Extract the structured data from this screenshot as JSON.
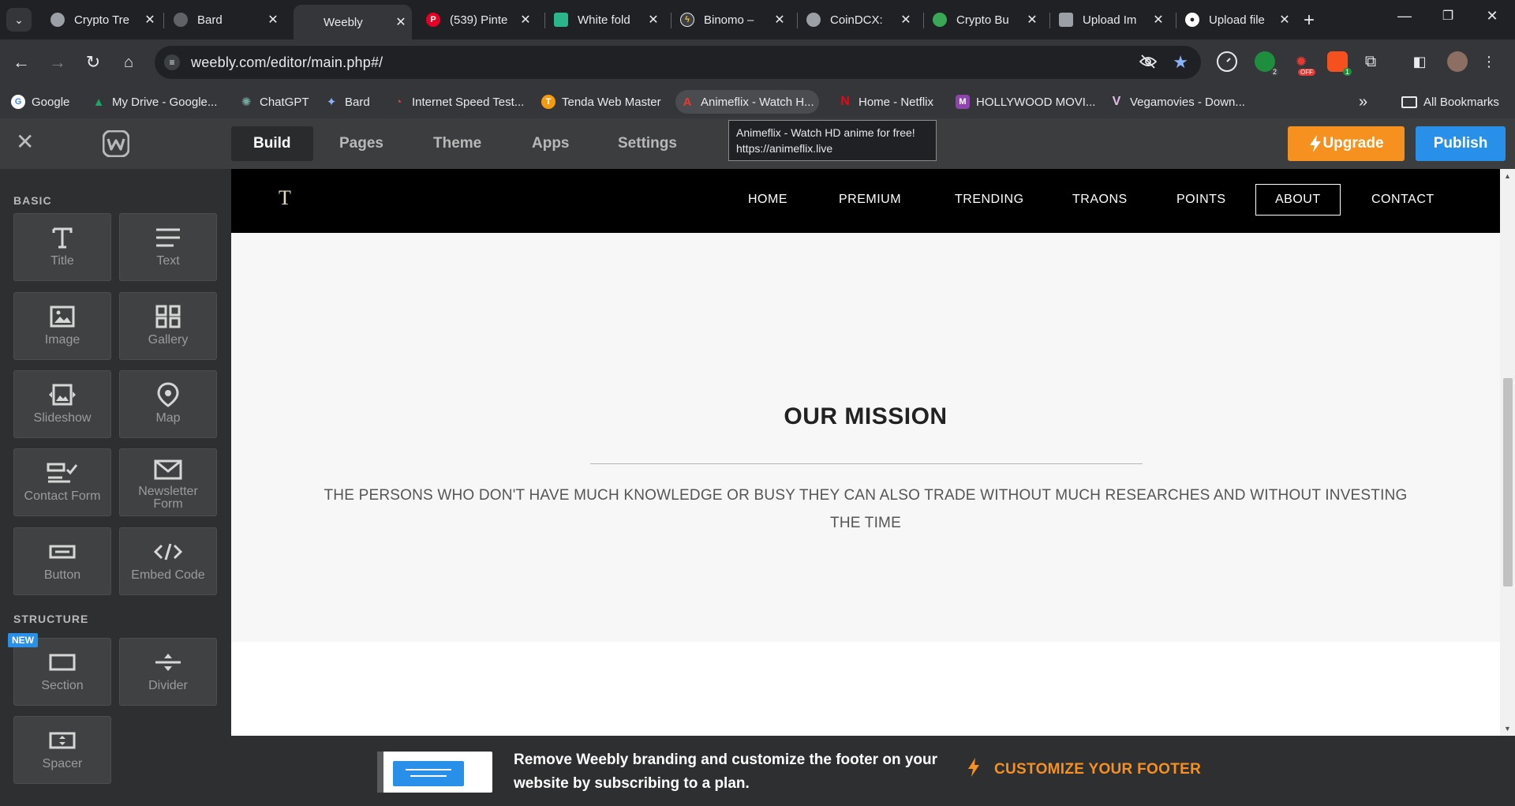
{
  "browser": {
    "tabs": [
      {
        "title": "Crypto Tre",
        "favicon_color": "#9aa0a6"
      },
      {
        "title": "Bard",
        "favicon_color": "#5f6368"
      },
      {
        "title": "Weebly",
        "favicon_color": "#35363a"
      },
      {
        "title": "(539) Pinte",
        "favicon_color": "#e60023"
      },
      {
        "title": "White fold",
        "favicon_color": "#2bb58a"
      },
      {
        "title": "Binomo – ",
        "favicon_color": "#3c4043"
      },
      {
        "title": "CoinDCX: ",
        "favicon_color": "#9aa0a6"
      },
      {
        "title": "Crypto Bu",
        "favicon_color": "#3aa757"
      },
      {
        "title": "Upload Im",
        "favicon_color": "#9aa0a6"
      },
      {
        "title": "Upload file",
        "favicon_color": "#ffffff"
      }
    ],
    "active_tab_index": 2,
    "close_glyph": "✕",
    "new_tab_glyph": "+",
    "url": "weebly.com/editor/main.php#/",
    "extension_badges": {
      "ext2": "2",
      "ext3": "OFF",
      "ext4": "1"
    },
    "bookmarks": [
      {
        "label": "Google",
        "color": "#ffffff",
        "glyph": "G"
      },
      {
        "label": "My Drive - Google...",
        "color": "#1fa463",
        "glyph": "▲"
      },
      {
        "label": "ChatGPT",
        "color": "#74aa9c",
        "glyph": "✺"
      },
      {
        "label": "Bard",
        "color": "#4285f4",
        "glyph": "✦"
      },
      {
        "label": "Internet Speed Test...",
        "color": "#c62828",
        "glyph": "◔"
      },
      {
        "label": "Tenda Web Master",
        "color": "#f39c12",
        "glyph": "T"
      },
      {
        "label": "Animeflix - Watch H...",
        "color": "#e53935",
        "glyph": "A"
      },
      {
        "label": "Home - Netflix",
        "color": "#e50914",
        "glyph": "N"
      },
      {
        "label": "HOLLYWOOD MOVI...",
        "color": "#8e44ad",
        "glyph": "M"
      },
      {
        "label": "Vegamovies - Down...",
        "color": "#9c27b0",
        "glyph": "V"
      }
    ],
    "more_bookmarks_glyph": "»",
    "all_bookmarks_label": "All Bookmarks",
    "tooltip": {
      "line1": "Animeflix - Watch HD anime for free!",
      "line2": "https://animeflix.live"
    }
  },
  "editor": {
    "tabs": [
      "Build",
      "Pages",
      "Theme",
      "Apps",
      "Settings"
    ],
    "active_tab": "Build",
    "upgrade_label": "Upgrade",
    "publish_label": "Publish",
    "sidebar": {
      "basic_heading": "BASIC",
      "structure_heading": "STRUCTURE",
      "new_badge": "NEW",
      "basic_elements": [
        "Title",
        "Text",
        "Image",
        "Gallery",
        "Slideshow",
        "Map",
        "Contact Form",
        "Newsletter Form",
        "Button",
        "Embed Code"
      ],
      "structure_elements": [
        "Section",
        "Divider",
        "Spacer"
      ]
    },
    "site": {
      "logo": "T",
      "nav": [
        "HOME",
        "PREMIUM",
        "TRENDING",
        "TRAONS",
        "POINTS",
        "ABOUT",
        "CONTACT"
      ],
      "selected_nav": "ABOUT",
      "mission_title": "OUR MISSION",
      "mission_text": "THE PERSONS WHO DON'T HAVE MUCH KNOWLEDGE OR BUSY THEY CAN ALSO TRADE WITHOUT MUCH RESEARCHES AND WITHOUT INVESTING THE TIME"
    },
    "footer_promo": {
      "text": "Remove Weebly branding and customize the footer on your website by subscribing to a plan.",
      "cta": "CUSTOMIZE YOUR FOOTER"
    }
  },
  "colors": {
    "upgrade": "#f6901e",
    "publish": "#2990ea",
    "cta": "#f6901e"
  }
}
